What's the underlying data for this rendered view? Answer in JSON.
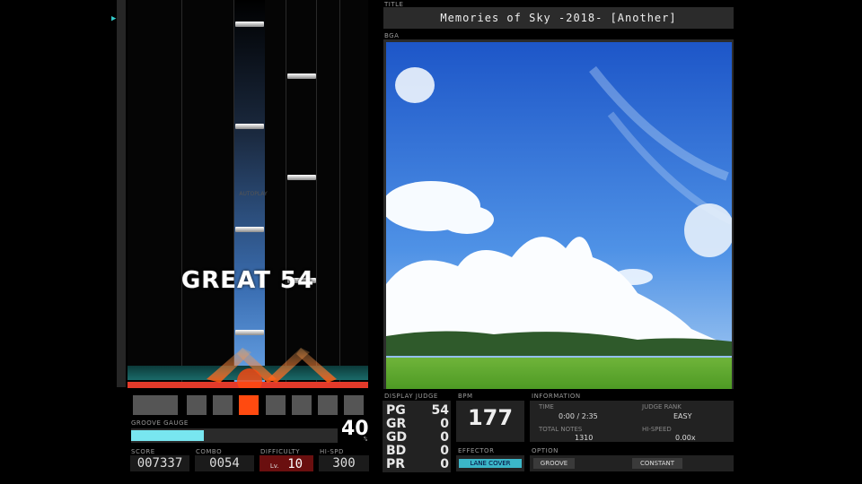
{
  "song": {
    "title_label": "TITLE",
    "title": "Memories of Sky -2018- [Another]",
    "bga_label": "BGA"
  },
  "play": {
    "judge_text": "GREAT 54",
    "autoplay_text": "AUTOPLAY"
  },
  "gauge": {
    "label": "GROOVE GAUGE",
    "value": "40",
    "unit": "%",
    "fill_percent": 40,
    "fill_color": "#78e6f0"
  },
  "stats": {
    "score_label": "SCORE",
    "score": "007337",
    "combo_label": "COMBO",
    "combo": "0054",
    "difficulty_label": "DIFFICULTY",
    "difficulty_prefix": "Lv.",
    "difficulty": "10",
    "hispeed_label": "HI-SPD",
    "hispeed": "300"
  },
  "judges": {
    "label": "DISPLAY JUDGE",
    "rows": [
      {
        "key": "PG",
        "value": "54"
      },
      {
        "key": "GR",
        "value": "0"
      },
      {
        "key": "GD",
        "value": "0"
      },
      {
        "key": "BD",
        "value": "0"
      },
      {
        "key": "PR",
        "value": "0"
      }
    ]
  },
  "bpm": {
    "label": "BPM",
    "value": "177"
  },
  "effector": {
    "label": "EFFECTOR",
    "value": "LANE COVER"
  },
  "information": {
    "label": "INFORMATION",
    "time_label": "TIME",
    "time": "0:00 /  2:35",
    "judgerank_label": "JUDGE RANK",
    "judgerank": "EASY",
    "total_notes_label": "TOTAL NOTES",
    "total_notes": "1310",
    "hispeed_label": "HI-SPEED",
    "hispeed": "0.00x"
  },
  "option": {
    "label": "OPTION",
    "gauge": "GROOVE",
    "speed": "CONSTANT"
  },
  "colors": {
    "accent": "#3cc",
    "judge_red": "#e33a2a",
    "difficulty_red": "#6a0f0f"
  }
}
